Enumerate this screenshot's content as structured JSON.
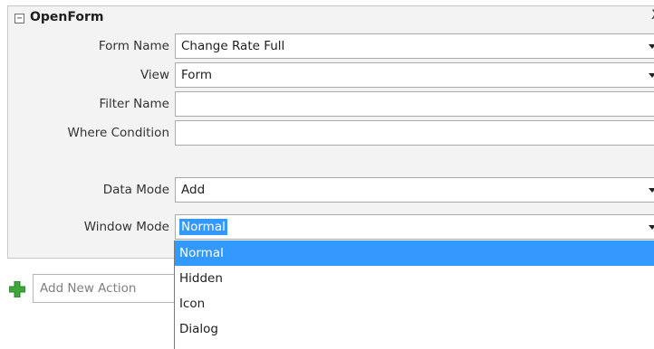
{
  "block": {
    "collapse_glyph": "−",
    "title": "OpenForm",
    "close_glyph": "X"
  },
  "fields": [
    {
      "label": "Form Name",
      "value": "Change Rate Full",
      "has_dropdown": true
    },
    {
      "label": "View",
      "value": "Form",
      "has_dropdown": true
    },
    {
      "label": "Filter Name",
      "value": "",
      "has_dropdown": false
    },
    {
      "label": "Where Condition",
      "value": "",
      "has_dropdown": false
    },
    {
      "label": "Data Mode",
      "value": "Add",
      "has_dropdown": true
    },
    {
      "label": "Window Mode",
      "value": "Normal",
      "has_dropdown": true
    }
  ],
  "add_action": {
    "placeholder": "Add New Action",
    "icon": "plus-icon"
  },
  "dropdown": {
    "options": [
      "Normal",
      "Hidden",
      "Icon",
      "Dialog"
    ],
    "highlighted_index": 0
  },
  "colors": {
    "selection": "#3399ff",
    "plus_green": "#3ea83b"
  }
}
